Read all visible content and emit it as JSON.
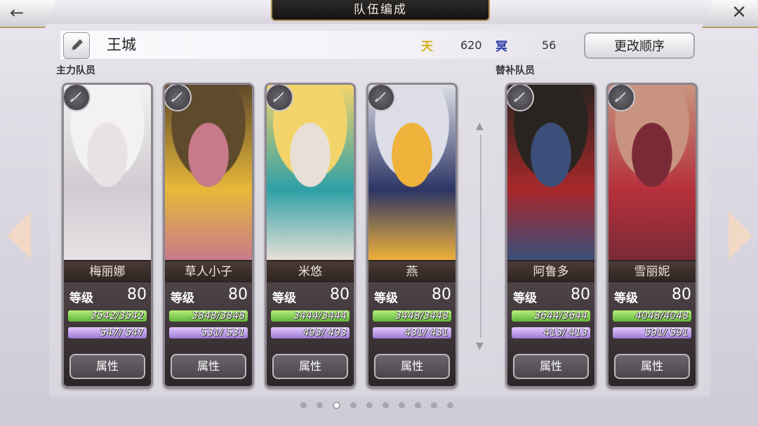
{
  "header": {
    "title": "队伍编成",
    "back_icon": "←",
    "close_icon": "✕"
  },
  "team": {
    "name": "王城",
    "stat1_icon": "天",
    "stat1_value": "620",
    "stat2_icon": "冥",
    "stat2_value": "56",
    "reorder_label": "更改顺序"
  },
  "sections": {
    "main": "主力队员",
    "reserve": "替补队员"
  },
  "members": [
    {
      "name": "梅丽娜",
      "level_label": "等级",
      "level": "80",
      "hp": "3542/3542",
      "mp": "547/ 547",
      "attr_label": "属性",
      "colors": [
        "#f3f1f2",
        "#cfcbd0",
        "#e8e2e6"
      ]
    },
    {
      "name": "草人小子",
      "level_label": "等级",
      "level": "80",
      "hp": "3848/3848",
      "mp": "531/ 531",
      "attr_label": "属性",
      "colors": [
        "#5f4a2b",
        "#e7b83a",
        "#c77a8a"
      ]
    },
    {
      "name": "米悠",
      "level_label": "等级",
      "level": "80",
      "hp": "3444/3444",
      "mp": "493/ 493",
      "attr_label": "属性",
      "colors": [
        "#f3d46a",
        "#2fa0a6",
        "#e8e0d6"
      ]
    },
    {
      "name": "燕",
      "level_label": "等级",
      "level": "80",
      "hp": "3448/3448",
      "mp": "431/ 431",
      "attr_label": "属性",
      "colors": [
        "#dcdde6",
        "#2c3565",
        "#efb23a"
      ]
    },
    {
      "name": "阿鲁多",
      "level_label": "等级",
      "level": "80",
      "hp": "3644/3644",
      "mp": "413/ 413",
      "attr_label": "属性",
      "colors": [
        "#2a2420",
        "#a8282a",
        "#3b4f7a"
      ]
    },
    {
      "name": "雪丽妮",
      "level_label": "等级",
      "level": "80",
      "hp": "4048/4048",
      "mp": "591/ 591",
      "attr_label": "属性",
      "colors": [
        "#c89480",
        "#b5303a",
        "#7a2a36"
      ]
    }
  ],
  "pager": {
    "count": 10,
    "active": 2
  }
}
